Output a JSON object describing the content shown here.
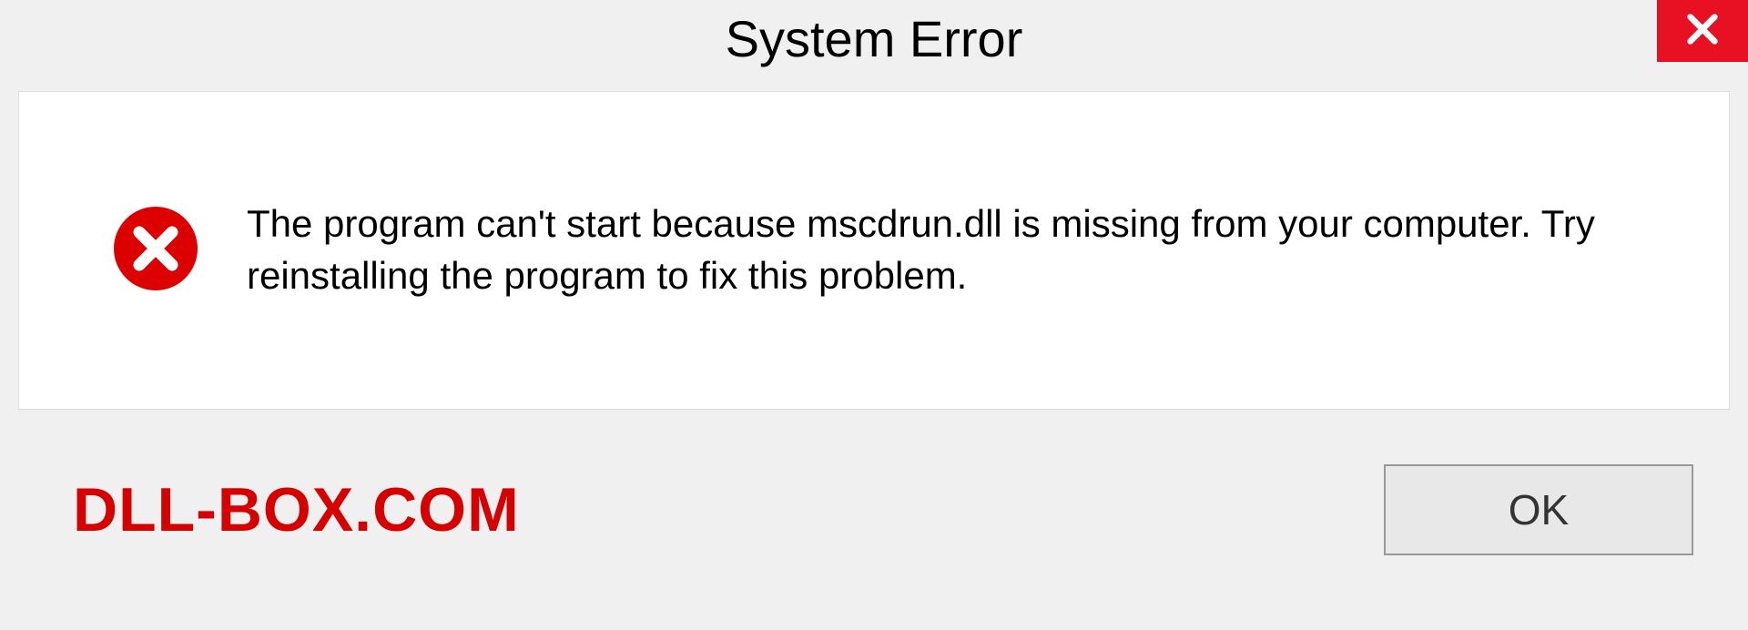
{
  "title": "System Error",
  "message": "The program can't start because mscdrun.dll is missing from your computer. Try reinstalling the program to fix this problem.",
  "brand": "DLL-BOX.COM",
  "ok_label": "OK"
}
